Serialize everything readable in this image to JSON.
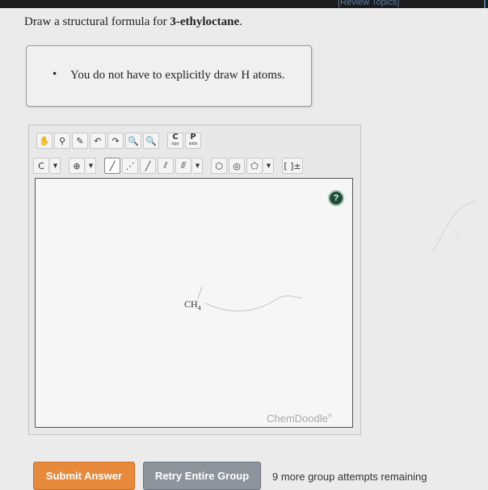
{
  "topbar": {
    "review_link": "[Review Topics]"
  },
  "question": {
    "prefix": "Draw a structural formula for ",
    "compound": "3-ethyloctane",
    "suffix": "."
  },
  "hint": {
    "bullet": "•",
    "text": "You do not have to explicitly draw H atoms."
  },
  "editor": {
    "toolbar_row1": [
      {
        "name": "hand-icon",
        "glyph": "✋"
      },
      {
        "name": "lasso-icon",
        "glyph": "⚲"
      },
      {
        "name": "eraser-icon",
        "glyph": "✎"
      },
      {
        "name": "undo-icon",
        "glyph": "↶"
      },
      {
        "name": "redo-icon",
        "glyph": "↷"
      },
      {
        "name": "zoom-in-icon",
        "glyph": "🔍"
      },
      {
        "name": "zoom-out-icon",
        "glyph": "🔍"
      }
    ],
    "copy_button": {
      "letter": "C",
      "sub": "opy"
    },
    "paste_button": {
      "letter": "P",
      "sub": "aste"
    },
    "element_selector": "C",
    "charge_button": "⊕",
    "bond_tools": [
      "╱",
      "⋰",
      "╱",
      "⫽",
      "⫻"
    ],
    "ring_tools": [
      "⬡",
      "◎",
      "⬠"
    ],
    "bracket_tool": "[ ]±",
    "help_button": "?",
    "molecule_label": "CH",
    "molecule_subscript": "4",
    "brand": "ChemDoodle",
    "brand_mark": "®"
  },
  "actions": {
    "submit": "Submit Answer",
    "retry": "Retry Entire Group",
    "attempts": "9 more group attempts remaining"
  },
  "colors": {
    "submit_bg": "#e78a3c",
    "retry_bg": "#8d949c",
    "help_bg": "#1e4d38"
  }
}
